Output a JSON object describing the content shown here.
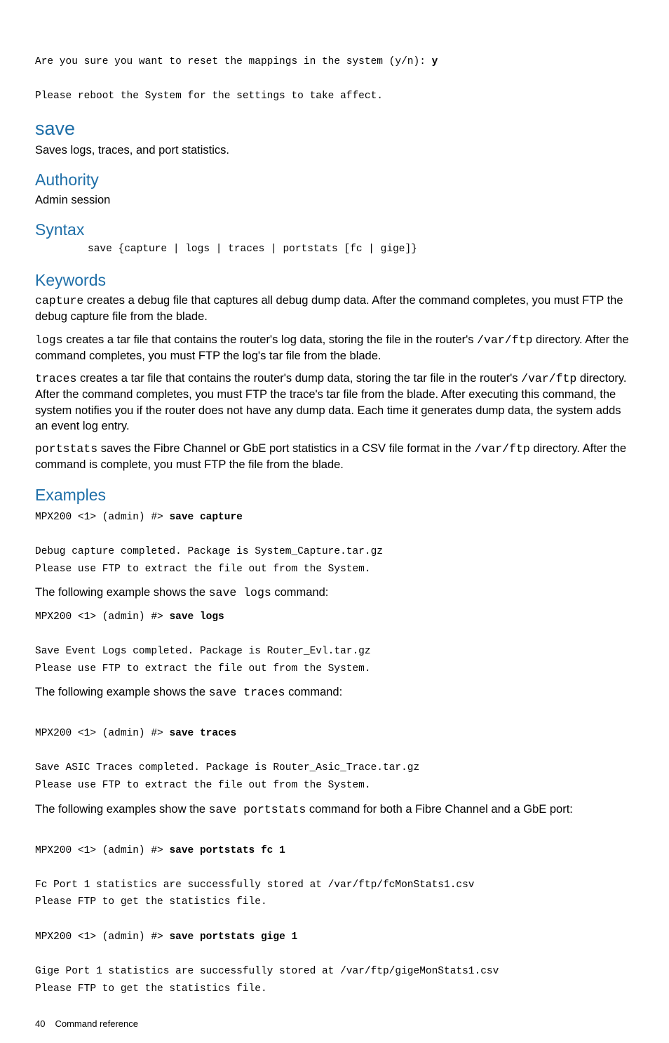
{
  "top": {
    "line1_a": "Are you sure you want to reset the mappings in the system (y/n): ",
    "line1_b": "y",
    "line2": "Please reboot the System for the settings to take affect."
  },
  "save": {
    "heading": "save",
    "desc": "Saves logs, traces, and port statistics."
  },
  "authority": {
    "heading": "Authority",
    "body": "Admin session"
  },
  "syntax": {
    "heading": "Syntax",
    "code": "save {capture | logs | traces | portstats [fc | gige]}"
  },
  "keywords": {
    "heading": "Keywords",
    "p1_code": "capture",
    "p1_rest": " creates a debug file that captures all debug dump data. After the command completes, you must FTP the debug capture file from the blade.",
    "p2_code": "logs",
    "p2_mid": " creates a tar file that contains the router's log data, storing the file in the router's ",
    "p2_code2": "/var/ftp",
    "p2_end": " directory. After the command completes, you must FTP the log's tar file from the blade.",
    "p3_code": "traces",
    "p3_mid": " creates a tar file that contains the router's dump data, storing the tar file in the router's ",
    "p3_code2": "/var/ftp",
    "p3_end": " directory. After the command completes, you must FTP the trace's tar file from the blade. After executing this command, the system notifies you if the router does not have any dump data. Each time it generates dump data, the system adds an event log entry.",
    "p4_code": "portstats",
    "p4_mid": " saves the Fibre Channel or GbE port statistics in a CSV file format in the ",
    "p4_code2": "/var/ftp",
    "p4_end": " directory. After the command is complete, you must FTP the file from the blade."
  },
  "examples": {
    "heading": "Examples",
    "ex1_prompt": "MPX200 <1> (admin) #> ",
    "ex1_cmd": "save capture",
    "ex1_out": "Debug capture completed. Package is System_Capture.tar.gz\nPlease use FTP to extract the file out from the System.",
    "intro2_a": "The following example shows the ",
    "intro2_code": "save logs",
    "intro2_b": " command:",
    "ex2_prompt": "MPX200 <1> (admin) #> ",
    "ex2_cmd": "save logs",
    "ex2_out": "Save Event Logs completed. Package is Router_Evl.tar.gz\nPlease use FTP to extract the file out from the System.",
    "intro3_a": "The following example shows the ",
    "intro3_code": "save traces",
    "intro3_b": " command:",
    "ex3_prompt": "MPX200 <1> (admin) #> ",
    "ex3_cmd": "save traces",
    "ex3_out": "Save ASIC Traces completed. Package is Router_Asic_Trace.tar.gz\nPlease use FTP to extract the file out from the System.",
    "intro4_a": "The following examples show the ",
    "intro4_code": "save portstats",
    "intro4_b": " command for both a Fibre Channel and a GbE port:",
    "ex4a_prompt": "MPX200 <1> (admin) #> ",
    "ex4a_cmd": "save portstats fc 1",
    "ex4a_out": "Fc Port 1 statistics are successfully stored at /var/ftp/fcMonStats1.csv\nPlease FTP to get the statistics file.",
    "ex4b_prompt": "MPX200 <1> (admin) #> ",
    "ex4b_cmd": "save portstats gige 1",
    "ex4b_out": "Gige Port 1 statistics are successfully stored at /var/ftp/gigeMonStats1.csv\nPlease FTP to get the statistics file."
  },
  "footer": {
    "page": "40",
    "title": "Command reference"
  }
}
